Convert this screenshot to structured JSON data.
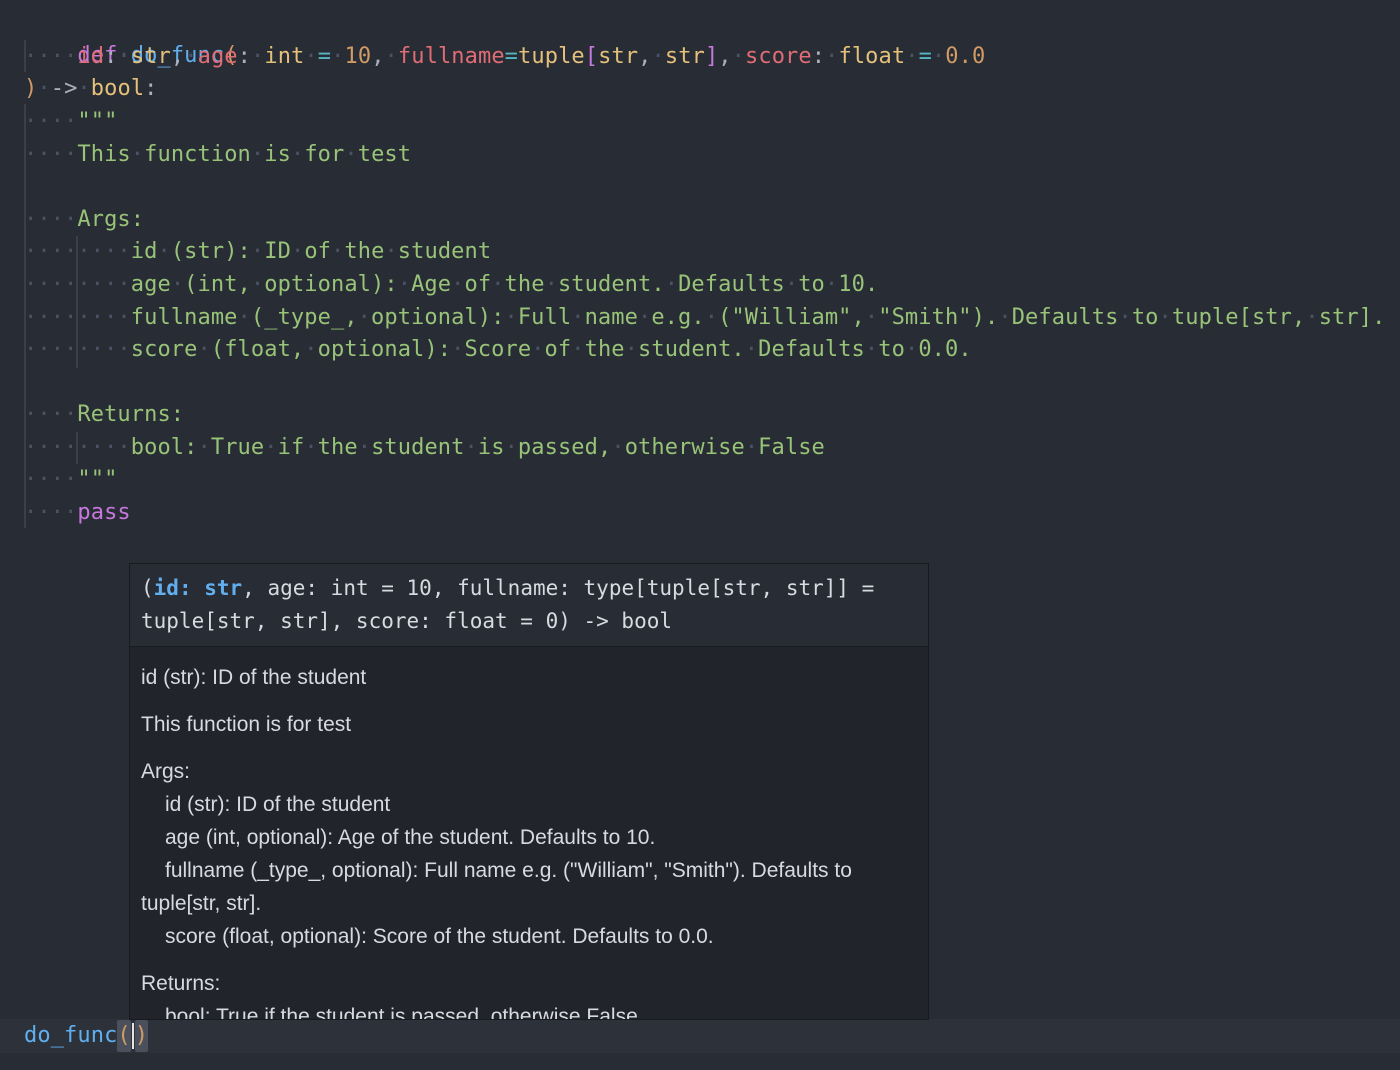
{
  "editor": {
    "line1": {
      "def": "def",
      "name": "do_func",
      "open": "("
    },
    "line2": {
      "p1": "id",
      "t1": "str",
      "p2": "age",
      "t2": "int",
      "v2": "10",
      "p3": "fullname",
      "t3": "tuple",
      "t3a": "str",
      "t3b": "str",
      "p4": "score",
      "t4": "float",
      "v4": "0.0"
    },
    "line3": {
      "close": ")",
      "arrow": "->",
      "ret": "bool",
      "colon": ":"
    },
    "docstring": {
      "quotes_open": "\"\"\"",
      "summary": "This function is for test",
      "args_header": "Args:",
      "args": [
        "id (str): ID of the student",
        "age (int, optional): Age of the student. Defaults to 10.",
        "fullname (_type_, optional): Full name e.g. (\"William\", \"Smith\"). Defaults to tuple[str, str].",
        "score (float, optional): Score of the student. Defaults to 0.0."
      ],
      "returns_header": "Returns:",
      "returns": "bool: True if the student is passed, otherwise False",
      "quotes_close": "\"\"\""
    },
    "pass_kw": "pass",
    "call_line": {
      "name": "do_func",
      "open": "(",
      "close": ")"
    }
  },
  "hover": {
    "signature_open": "(",
    "signature_active": "id: str",
    "signature_rest": ", age: int = 10, fullname: type[tuple[str, str]] = tuple[str, str], score: float = 0) -> bool",
    "param_doc": "id (str): ID of the student",
    "summary": "This function is for test",
    "args_header": "Args:",
    "args": [
      "id (str): ID of the student",
      "age (int, optional): Age of the student. Defaults to 10.",
      "fullname (_type_, optional): Full name e.g. (\"William\", \"Smith\"). Defaults to tuple[str, str].",
      "score (float, optional): Score of the student. Defaults to 0.0."
    ],
    "returns_header": "Returns:",
    "returns": "bool: True if the student is passed, otherwise False"
  },
  "colors": {
    "background": "#282c34",
    "keyword": "#c678dd",
    "function": "#61afef",
    "parameter": "#e06c75",
    "type": "#e5c07b",
    "number": "#d19a66",
    "string": "#98c379"
  }
}
